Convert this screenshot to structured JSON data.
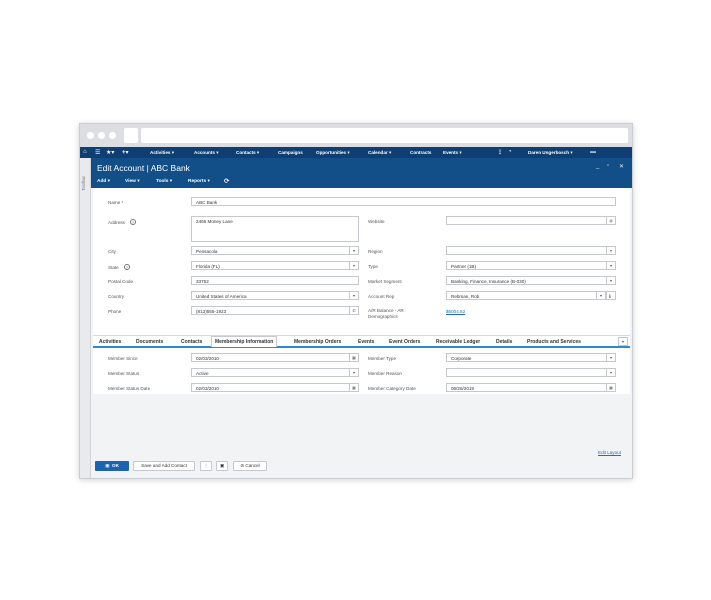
{
  "nav": {
    "items": [
      "Activities",
      "Accounts",
      "Contacts",
      "Campaigns",
      "Opportunities",
      "Calendar",
      "Contracts",
      "Events"
    ],
    "user": "Daren Ungerbosch"
  },
  "sidebar": {
    "label": "Toolbar"
  },
  "header": {
    "title": "Edit Account | ABC Bank",
    "toolbar": {
      "add": "Add",
      "view": "View",
      "tools": "Tools",
      "reports": "Reports"
    }
  },
  "form": {
    "name": {
      "label": "Name *",
      "value": "ABC Bank"
    },
    "address": {
      "label": "Address",
      "value": "2465 Money Lane"
    },
    "website": {
      "label": "Website",
      "value": ""
    },
    "city": {
      "label": "City",
      "value": "Pensacola"
    },
    "region": {
      "label": "Region",
      "value": ""
    },
    "state": {
      "label": "State",
      "value": "Florida (FL)"
    },
    "type": {
      "label": "Type",
      "value": "Partner (1B)"
    },
    "postal_code": {
      "label": "Postal Code",
      "value": "33752"
    },
    "market_segment": {
      "label": "Market Segment",
      "value": "Banking, Finance, Insurance (B-030)"
    },
    "country": {
      "label": "Country",
      "value": "United States of America"
    },
    "account_rep": {
      "label": "Account Rep",
      "value": "Rebman, Rob"
    },
    "phone": {
      "label": "Phone",
      "value": "(813)555-1923"
    },
    "ar_balance": {
      "label": "A/R Balance - AR Demographics",
      "value": "$6004.62"
    }
  },
  "tabs": [
    "Activities",
    "Documents",
    "Contacts",
    "Membership Information",
    "Membership Orders",
    "Events",
    "Event Orders",
    "Receivable Ledger",
    "Details",
    "Products and Services"
  ],
  "membership": {
    "member_since": {
      "label": "Member Since",
      "value": "02/03/2010"
    },
    "member_type": {
      "label": "Member Type",
      "value": "Corporate"
    },
    "member_status": {
      "label": "Member Status",
      "value": "Active"
    },
    "member_reason": {
      "label": "Member Reason",
      "value": ""
    },
    "member_status_date": {
      "label": "Member Status Date",
      "value": "02/03/2010"
    },
    "member_category_date": {
      "label": "Member Category Date",
      "value": "06/26/2019"
    }
  },
  "edit_layout": "Edit Layout",
  "footer": {
    "ok": "OK",
    "save_add_contact": "Save and Add Contact",
    "cancel": "Cancel"
  }
}
